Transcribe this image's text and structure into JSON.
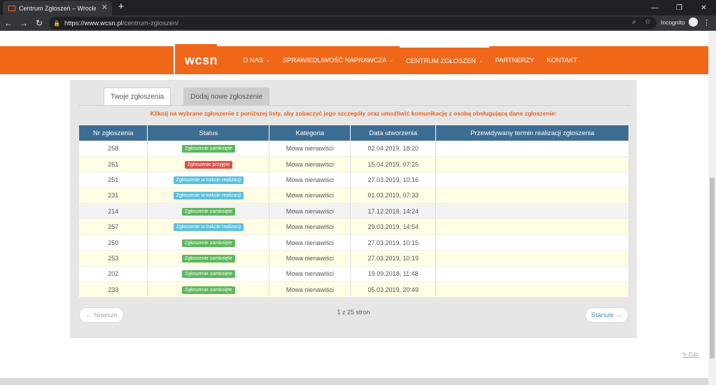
{
  "browser": {
    "tab_title": "Centrum Zgłoszeń – Wrocławskie",
    "tab_close": "✕",
    "new_tab": "+",
    "url_host": "https://www.wcsn.pl",
    "url_path": "/centrum-zgloszen/",
    "profile_label": "Incognito"
  },
  "site": {
    "logo_text": "wcsn",
    "nav": [
      {
        "label": "O NAS",
        "caret": "⌄"
      },
      {
        "label": "SPRAWIEDLIWOŚĆ NAPRAWCZA",
        "caret": "⌄"
      },
      {
        "label": "CENTRUM ZGŁOSZEŃ",
        "caret": "⌄"
      },
      {
        "label": "PARTNERZY",
        "caret": ""
      },
      {
        "label": "KONTAKT",
        "caret": ""
      }
    ]
  },
  "panel": {
    "tab_mine": "Twoje zgłoszenia",
    "tab_new": "Dodaj nowe zgłoszenie",
    "instruction": "Kliknij na wybrane zgłoszenie z poniższej listy, aby zobaczyć jego szczegóły oraz umożliwić komunikację z osobą obsługującą dane zgłoszenie:",
    "columns": {
      "number": "Nr zgłoszenia",
      "status": "Status",
      "category": "Kategoria",
      "created": "Data utworzenia",
      "due": "Przewidywany termin realizacji zgłoszenia"
    },
    "rows": [
      {
        "number": "258",
        "status": "Zgłoszenie zamknięte",
        "category": "Mowa nienawiści",
        "created": "02.04.2019, 18:20",
        "due": ""
      },
      {
        "number": "261",
        "status": "Zgłoszenie przyjęte",
        "category": "Mowa nienawiści",
        "created": "15.04.2019, 07:25",
        "due": ""
      },
      {
        "number": "251",
        "status": "Zgłoszenie w trakcie realizacji",
        "category": "Mowa nienawiści",
        "created": "27.03.2019, 10:16",
        "due": ""
      },
      {
        "number": "231",
        "status": "Zgłoszenie w trakcie realizacji",
        "category": "Mowa nienawiści",
        "created": "01.03.2019, 07:33",
        "due": ""
      },
      {
        "number": "214",
        "status": "Zgłoszenie zamknięte",
        "category": "Mowa nienawiści",
        "created": "17.12.2018, 14:24",
        "due": ""
      },
      {
        "number": "257",
        "status": "Zgłoszenie w trakcie realizacji",
        "category": "Mowa nienawiści",
        "created": "29.03.2019, 14:54",
        "due": ""
      },
      {
        "number": "250",
        "status": "Zgłoszenie zamknięte",
        "category": "Mowa nienawiści",
        "created": "27.03.2019, 10:15",
        "due": ""
      },
      {
        "number": "253",
        "status": "Zgłoszenie zamknięte",
        "category": "Mowa nienawiści",
        "created": "27.03.2019, 10:19",
        "due": ""
      },
      {
        "number": "202",
        "status": "Zgłoszenie zamknięte",
        "category": "Mowa nienawiści",
        "created": "19.09.2018, 11:48",
        "due": ""
      },
      {
        "number": "233",
        "status": "Zgłoszenie zamknięte",
        "category": "Mowa nienawiści",
        "created": "05.03.2019, 20:49",
        "due": ""
      }
    ],
    "pager_prev": "← Nowsze",
    "pager_next": "Starsze →",
    "pager_info": "1 z 25 stron"
  },
  "edit_label": "Edit",
  "colors": {
    "brand_orange": "#f06719",
    "table_header": "#3d6d93",
    "status_closed": "#5cb85c",
    "status_accepted": "#d9534f",
    "status_progress": "#5bc0de"
  }
}
